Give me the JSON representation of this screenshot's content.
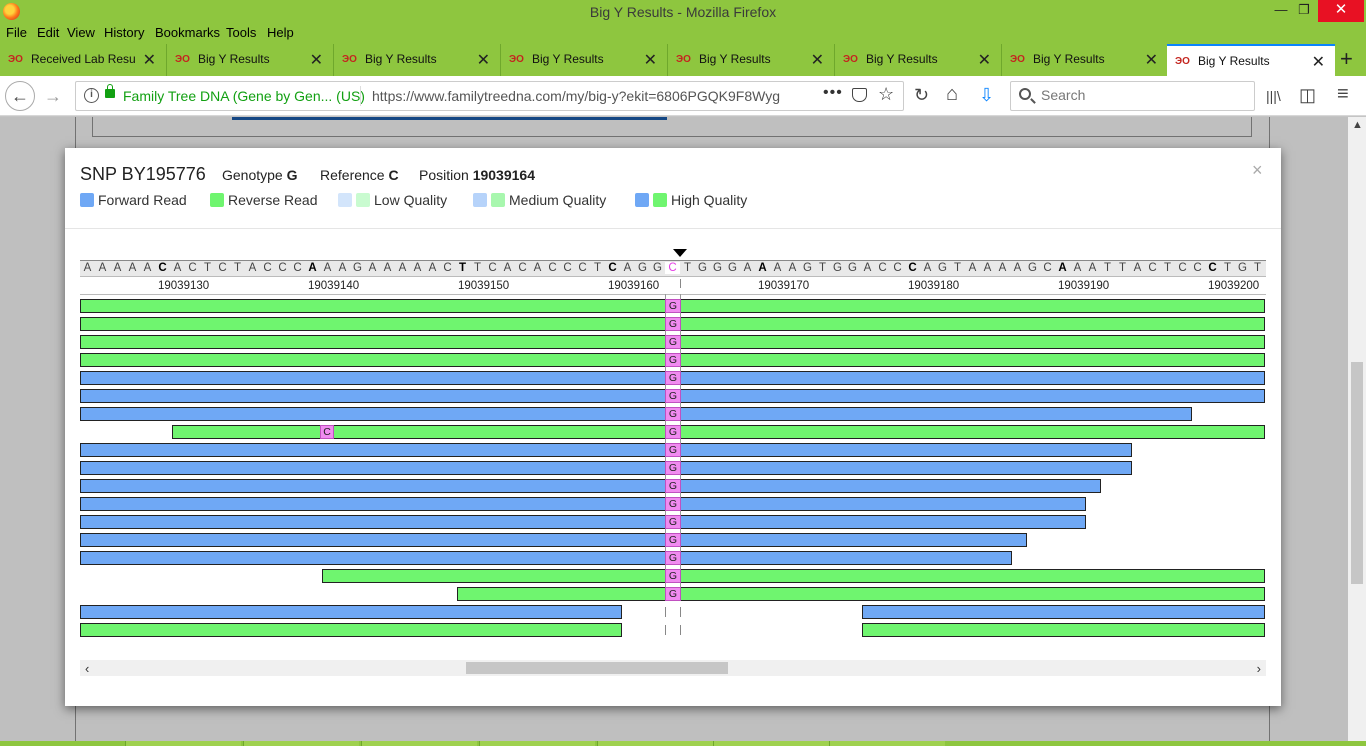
{
  "window": {
    "title": "Big Y Results - Mozilla Firefox",
    "minimize": "—",
    "restore": "❐",
    "close": "✕"
  },
  "menu": [
    "File",
    "Edit",
    "View",
    "History",
    "Bookmarks",
    "Tools",
    "Help"
  ],
  "tabs": [
    {
      "label": "Received Lab Results",
      "active": false
    },
    {
      "label": "Big Y Results",
      "active": false
    },
    {
      "label": "Big Y Results",
      "active": false
    },
    {
      "label": "Big Y Results",
      "active": false
    },
    {
      "label": "Big Y Results",
      "active": false
    },
    {
      "label": "Big Y Results",
      "active": false
    },
    {
      "label": "Big Y Results",
      "active": false
    },
    {
      "label": "Big Y Results",
      "active": true
    }
  ],
  "tab_icon_text": "ЭО",
  "tab_close": "✕",
  "new_tab": "+",
  "nav": {
    "back": "←",
    "forward": "→",
    "site_identity": "Family Tree DNA (Gene by Gen... (US)",
    "url": "https://www.familytreedna.com/my/big-y?ekit=6806PGQK9F8Wyg",
    "more": "•••",
    "star": "☆",
    "reload": "↻",
    "home": "⌂",
    "download": "⇩",
    "library": "|||\\",
    "sidebar": "◫",
    "menu": "≡",
    "search_placeholder": "Search"
  },
  "modal": {
    "snp_name": "SNP BY195776",
    "genotype_label": "Genotype",
    "genotype_value": "G",
    "reference_label": "Reference",
    "reference_value": "C",
    "position_label": "Position",
    "position_value": "19039164",
    "close": "×",
    "legend": [
      {
        "label": "Forward Read",
        "colors": [
          "#6fa8f5"
        ]
      },
      {
        "label": "Reverse Read",
        "colors": [
          "#6ff56f"
        ]
      },
      {
        "label": "Low Quality",
        "colors": [
          "#d3e5fb",
          "#c9fbd0"
        ]
      },
      {
        "label": "Medium Quality",
        "colors": [
          "#b6d3fa",
          "#a8f7ae"
        ]
      },
      {
        "label": "High Quality",
        "colors": [
          "#6fa8f5",
          "#6ff56f"
        ]
      }
    ]
  },
  "viewer": {
    "reference_sequence": "AAAAACACTCTACCCAAAGAAAAACTTCACACCCTCAGGCTGGGAAAAGTGGACCCAGTAAAAGCAAATTACTCCCTGT",
    "bold_indices": [
      5,
      15,
      25,
      35,
      45,
      55,
      65,
      75
    ],
    "snp_index": 39,
    "position_labels": [
      "19039130",
      "19039140",
      "19039150",
      "19039160",
      "19039170",
      "19039180",
      "19039190",
      "19039200"
    ],
    "genotype_call": "G",
    "mismatch_call": "C",
    "scroll_left": "‹",
    "scroll_right": "›",
    "reads": [
      {
        "dir": "rev",
        "start": 0,
        "end": 79
      },
      {
        "dir": "rev",
        "start": 0,
        "end": 79
      },
      {
        "dir": "rev",
        "start": 0,
        "end": 79
      },
      {
        "dir": "rev",
        "start": 0,
        "end": 79
      },
      {
        "dir": "fwd",
        "start": 0,
        "end": 79
      },
      {
        "dir": "fwd",
        "start": 0,
        "end": 79
      },
      {
        "dir": "fwd",
        "start": 0,
        "end": 74.1
      },
      {
        "dir": "rev",
        "start": 6.1,
        "end": 79,
        "mismatch": 16
      },
      {
        "dir": "fwd",
        "start": 0,
        "end": 70.1
      },
      {
        "dir": "fwd",
        "start": 0,
        "end": 70.1
      },
      {
        "dir": "fwd",
        "start": 0,
        "end": 68.1
      },
      {
        "dir": "fwd",
        "start": 0,
        "end": 67.1
      },
      {
        "dir": "fwd",
        "start": 0,
        "end": 67.1
      },
      {
        "dir": "fwd",
        "start": 0,
        "end": 63.1
      },
      {
        "dir": "fwd",
        "start": 0,
        "end": 62.1
      },
      {
        "dir": "rev",
        "start": 16.1,
        "end": 79
      },
      {
        "dir": "rev",
        "start": 25.1,
        "end": 79
      },
      {
        "dir": "fwd",
        "start": 0,
        "end": 36.1,
        "gap": true,
        "start2": 52.1,
        "end2": 79
      },
      {
        "dir": "rev",
        "start": 0,
        "end": 36.1,
        "gap": true,
        "start2": 52.1,
        "end2": 79
      }
    ]
  }
}
